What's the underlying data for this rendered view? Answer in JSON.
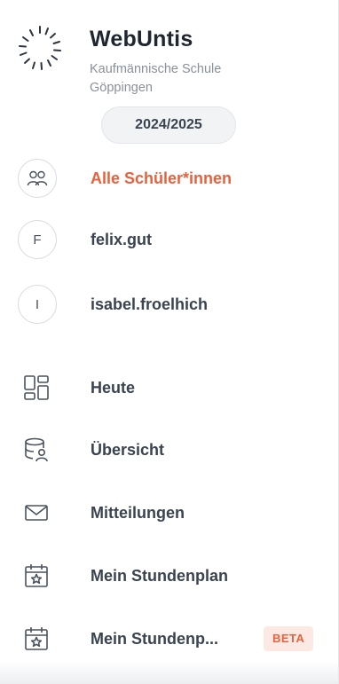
{
  "header": {
    "app_title": "WebUntis",
    "school_line1": "Kaufmännische Schule",
    "school_line2": "Göppingen",
    "school_year": "2024/2025",
    "logo_icon": "sun-rays-logo"
  },
  "people": [
    {
      "label": "Alle Schüler*innen",
      "icon": "group-icon",
      "accent": "#e8613c"
    },
    {
      "label": "felix.gut",
      "initial": "F"
    },
    {
      "label": "isabel.froelhich",
      "initial": "I"
    }
  ],
  "nav": [
    {
      "label": "Heute",
      "icon": "dashboard-grid-icon"
    },
    {
      "label": "Übersicht",
      "icon": "overview-user-icon"
    },
    {
      "label": "Mitteilungen",
      "icon": "envelope-icon"
    },
    {
      "label": "Mein Stundenplan",
      "icon": "calendar-star-icon"
    },
    {
      "label": "Mein Stundenp...",
      "icon": "calendar-star-icon",
      "badge": "BETA"
    }
  ],
  "colors": {
    "accent": "#e8613c",
    "text": "#3a4350",
    "muted": "#8a9099",
    "beta_bg": "#fde9e3"
  }
}
